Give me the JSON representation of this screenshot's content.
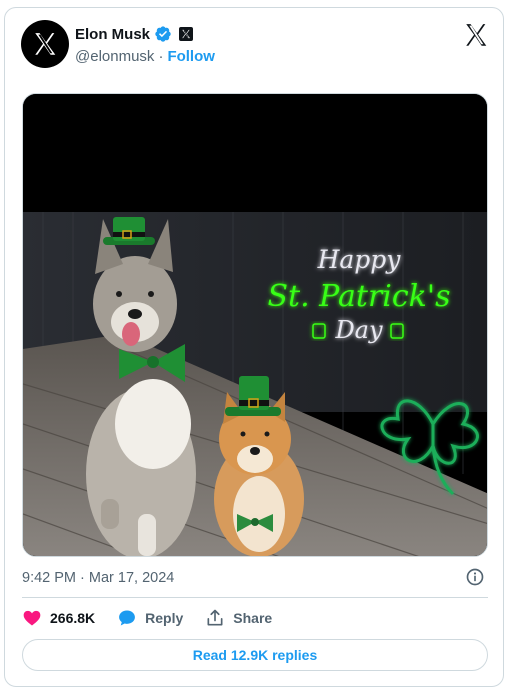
{
  "author": {
    "name": "Elon Musk",
    "handle": "@elonmusk",
    "separator": "·",
    "follow_label": "Follow"
  },
  "media": {
    "sign_line1": "Happy",
    "sign_line2": "St. Patrick's",
    "sign_line3": "Day"
  },
  "tweet": {
    "timestamp": "9:42 PM · Mar 17, 2024"
  },
  "actions": {
    "likes": "266.8K",
    "reply_label": "Reply",
    "share_label": "Share"
  },
  "footer": {
    "read_replies_label": "Read 12.9K replies"
  },
  "colors": {
    "accent": "#1d9bf0",
    "like": "#f91880",
    "neon_green": "#39ff14",
    "text_secondary": "#536471"
  },
  "icons": [
    "x-logo-icon",
    "verified-badge-icon",
    "x-affiliate-badge-icon",
    "info-icon",
    "heart-icon",
    "reply-bubble-icon",
    "share-icon"
  ]
}
